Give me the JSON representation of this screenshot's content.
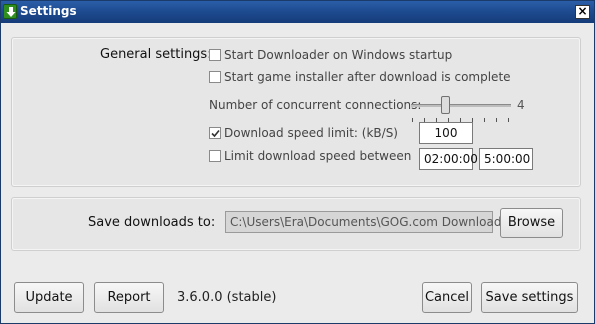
{
  "window": {
    "title": "Settings",
    "app_icon": "download-arrow-icon",
    "close_label": "×"
  },
  "general": {
    "section_label": "General settings:",
    "start_on_startup": {
      "label": "Start Downloader on Windows startup",
      "checked": false
    },
    "start_installer": {
      "label": "Start game installer after download is complete",
      "checked": false
    },
    "connections": {
      "label": "Number of concurrent connections:",
      "value": "4"
    },
    "speed_limit": {
      "label": "Download speed limit: (kB/S)",
      "checked": true,
      "value": "100"
    },
    "limit_between": {
      "label": "Limit download speed between",
      "checked": false,
      "from": "02:00:00",
      "to": "5:00:00"
    }
  },
  "save": {
    "label": "Save downloads to:",
    "path": "C:\\Users\\Era\\Documents\\GOG.com Downloads",
    "browse_label": "Browse"
  },
  "footer": {
    "update_label": "Update",
    "report_label": "Report",
    "version": "3.6.0.0 (stable)",
    "cancel_label": "Cancel",
    "save_settings_label": "Save settings"
  }
}
